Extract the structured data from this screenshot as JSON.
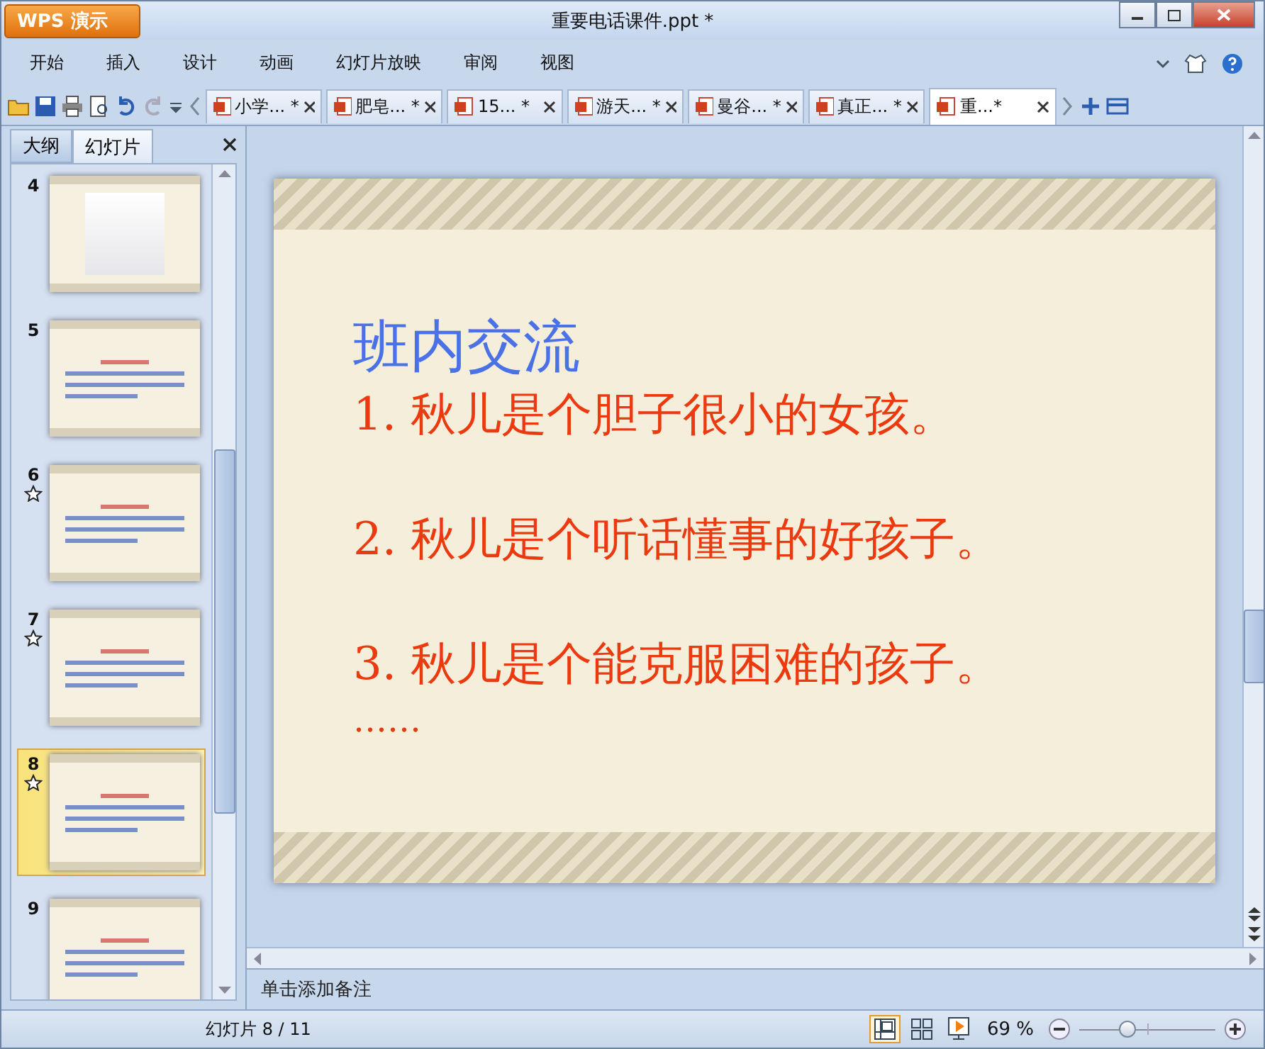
{
  "window": {
    "app_button": "WPS 演示",
    "title": "重要电话课件.ppt *"
  },
  "menu": [
    "开始",
    "插入",
    "设计",
    "动画",
    "幻灯片放映",
    "审阅",
    "视图"
  ],
  "doc_tabs": [
    {
      "label": "小学... *",
      "selected": false
    },
    {
      "label": "肥皂... *",
      "selected": false
    },
    {
      "label": "15... *",
      "selected": false
    },
    {
      "label": "游天... *",
      "selected": false
    },
    {
      "label": "曼谷... *",
      "selected": false
    },
    {
      "label": "真正... *",
      "selected": false
    },
    {
      "label": "重...*",
      "selected": true
    }
  ],
  "panel_tabs": [
    {
      "label": "大纲",
      "selected": false
    },
    {
      "label": "幻灯片",
      "selected": true
    }
  ],
  "thumbnails": [
    {
      "number": "4",
      "kind": "photo",
      "animated": false,
      "selected": false
    },
    {
      "number": "5",
      "kind": "text",
      "animated": false,
      "selected": false
    },
    {
      "number": "6",
      "kind": "text",
      "animated": true,
      "selected": false
    },
    {
      "number": "7",
      "kind": "text",
      "animated": true,
      "selected": false
    },
    {
      "number": "8",
      "kind": "text",
      "animated": true,
      "selected": true
    },
    {
      "number": "9",
      "kind": "text",
      "animated": false,
      "selected": false
    }
  ],
  "slide": {
    "title": "班内交流",
    "lines": [
      "1. 秋儿是个胆子很小的女孩。",
      "2. 秋儿是个听话懂事的好孩子。",
      "3. 秋儿是个能克服困难的孩子。"
    ],
    "ellipsis": "……"
  },
  "notes": {
    "placeholder": "单击添加备注"
  },
  "status_bar": {
    "slide_counter": "幻灯片 8 / 11",
    "zoom": "69 %",
    "zoom_slider": {
      "level": 0.35
    }
  }
}
